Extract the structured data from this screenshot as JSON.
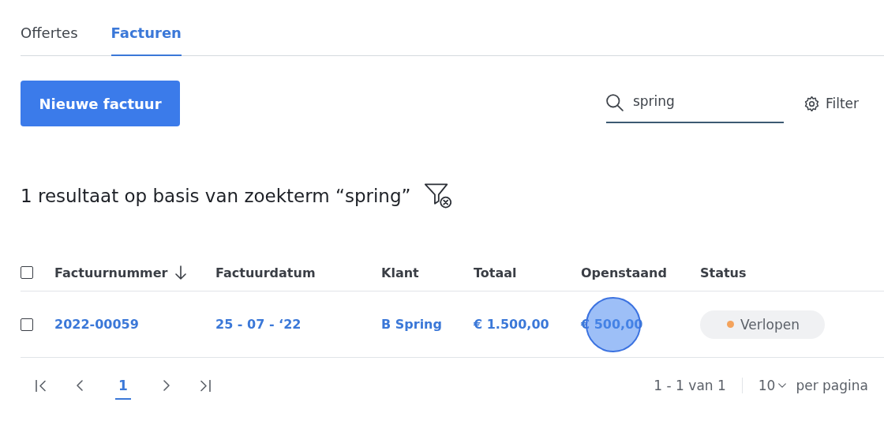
{
  "tabs": [
    {
      "label": "Offertes",
      "selected": false
    },
    {
      "label": "Facturen",
      "selected": true
    }
  ],
  "new_button": "Nieuwe factuur",
  "search": {
    "value": "spring"
  },
  "filter_button": "Filter",
  "result_text": "1 resultaat op basis van zoekterm “spring”",
  "table": {
    "columns": [
      {
        "label": "Factuurnummer",
        "sorted": true
      },
      {
        "label": "Factuurdatum",
        "sorted": false
      },
      {
        "label": "Klant",
        "sorted": false
      },
      {
        "label": "Totaal",
        "sorted": false
      },
      {
        "label": "Openstaand",
        "sorted": false
      },
      {
        "label": "Status",
        "sorted": false
      }
    ],
    "header_checked": false,
    "rows": [
      {
        "checked": false,
        "cells": [
          {
            "text": "2022-00059",
            "clicked": false
          },
          {
            "text": "25 - 07 - ‘22",
            "clicked": false
          },
          {
            "text": "B Spring",
            "clicked": false
          },
          {
            "text": "€ 1.500,00",
            "clicked": false
          },
          {
            "text": "€ 500,00",
            "clicked": true
          }
        ],
        "status": {
          "label": "Verlopen",
          "color": "#f4a35c"
        }
      }
    ]
  },
  "pagination": {
    "pages": [
      {
        "label": "1",
        "selected": true
      }
    ],
    "range": "1 - 1 van 1",
    "per_page_value": "10",
    "per_page_label": "per pagina"
  }
}
